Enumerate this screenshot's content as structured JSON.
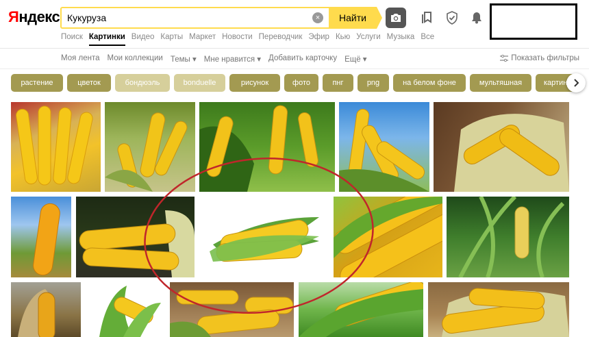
{
  "logo": {
    "first_letter": "Я",
    "rest": "ндекс"
  },
  "search": {
    "query": "Кукуруза",
    "clear_symbol": "×",
    "button_label": "Найти"
  },
  "services": [
    "Поиск",
    "Картинки",
    "Видео",
    "Карты",
    "Маркет",
    "Новости",
    "Переводчик",
    "Эфир",
    "Кью",
    "Услуги",
    "Музыка",
    "Все"
  ],
  "active_service_index": 1,
  "subnav": {
    "items": [
      "Моя лента",
      "Мои коллекции",
      "Темы ▾",
      "Мне нравится ▾",
      "Добавить карточку",
      "Ещё ▾"
    ],
    "filters_label": "Показать фильтры"
  },
  "chips": [
    {
      "label": "растение",
      "style": "dark"
    },
    {
      "label": "цветок",
      "style": "dark"
    },
    {
      "label": "бондюэль",
      "style": "light"
    },
    {
      "label": "bonduelle",
      "style": "light"
    },
    {
      "label": "рисунок",
      "style": "dark"
    },
    {
      "label": "фото",
      "style": "dark"
    },
    {
      "label": "пнг",
      "style": "dark"
    },
    {
      "label": "png",
      "style": "dark"
    },
    {
      "label": "на белом фоне",
      "style": "dark"
    },
    {
      "label": "мультяшная",
      "style": "dark"
    },
    {
      "label": "картин",
      "style": "dark"
    }
  ],
  "colors": {
    "accent_yellow": "#ffdb4d",
    "chip_dark": "#a39a51",
    "chip_light": "#d6cf9b",
    "annotation_red": "#c0262b"
  },
  "icons": [
    "search-clear-icon",
    "camera-icon",
    "collections-icon",
    "shield-icon",
    "bell-icon",
    "filters-icon",
    "chevron-right-icon"
  ],
  "image_results": {
    "count_visible": 16,
    "rows": [
      [
        "corn cobs on a plate",
        "corn cobs in husks",
        "corn on the stalk",
        "corn against blue sky",
        "husked corn cobs"
      ],
      [
        "corn cob close-up",
        "corn cobs on dark background",
        "single corn cob on white",
        "corn macro",
        "corn field"
      ],
      [
        "dried corn on the stalk",
        "corn on white background",
        "corn on wooden table",
        "corn in green leaves",
        "corn cobs in husk"
      ]
    ]
  }
}
